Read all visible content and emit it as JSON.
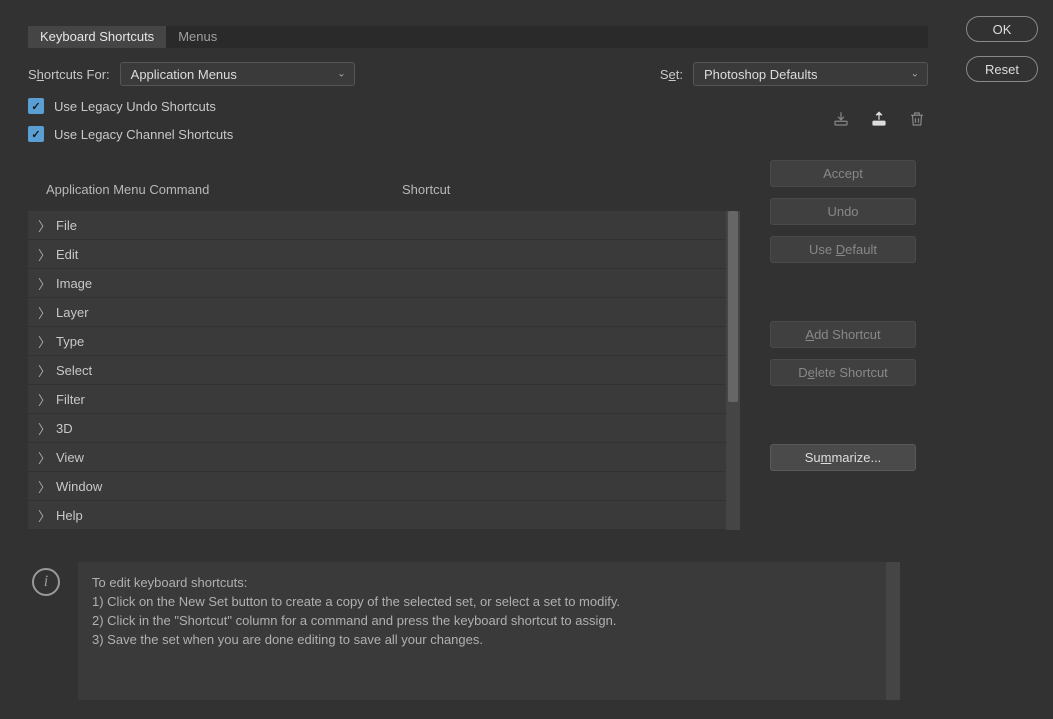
{
  "tabs": {
    "shortcuts": "Keyboard Shortcuts",
    "menus": "Menus"
  },
  "shortcutsFor": {
    "label_pre": "S",
    "label_u": "h",
    "label_post": "ortcuts For:",
    "value": "Application Menus"
  },
  "set": {
    "label_pre": "S",
    "label_u": "e",
    "label_post": "t:",
    "value": "Photoshop Defaults"
  },
  "checkboxes": {
    "legacyUndo": "Use Legacy Undo Shortcuts",
    "legacyChannel": "Use Legacy Channel Shortcuts"
  },
  "tableHeaders": {
    "command": "Application Menu Command",
    "shortcut": "Shortcut"
  },
  "menuItems": [
    "File",
    "Edit",
    "Image",
    "Layer",
    "Type",
    "Select",
    "Filter",
    "3D",
    "View",
    "Window",
    "Help"
  ],
  "sideButtons": {
    "accept": "Accept",
    "undo": "Undo",
    "useDefault_pre": "Use ",
    "useDefault_u": "D",
    "useDefault_post": "efault",
    "addShortcut_u": "A",
    "addShortcut_post": "dd Shortcut",
    "deleteShortcut_pre": "D",
    "deleteShortcut_u": "e",
    "deleteShortcut_post": "lete Shortcut",
    "summarize_pre": "Su",
    "summarize_u": "m",
    "summarize_post": "marize..."
  },
  "rightButtons": {
    "ok": "OK",
    "reset": "Reset"
  },
  "info": {
    "line0": "To edit keyboard shortcuts:",
    "line1": "1) Click on the New Set button to create a copy of the selected set, or select a set to modify.",
    "line2": "2) Click in the \"Shortcut\" column for a command and press the keyboard shortcut to assign.",
    "line3": "3) Save the set when you are done editing to save all your changes."
  }
}
